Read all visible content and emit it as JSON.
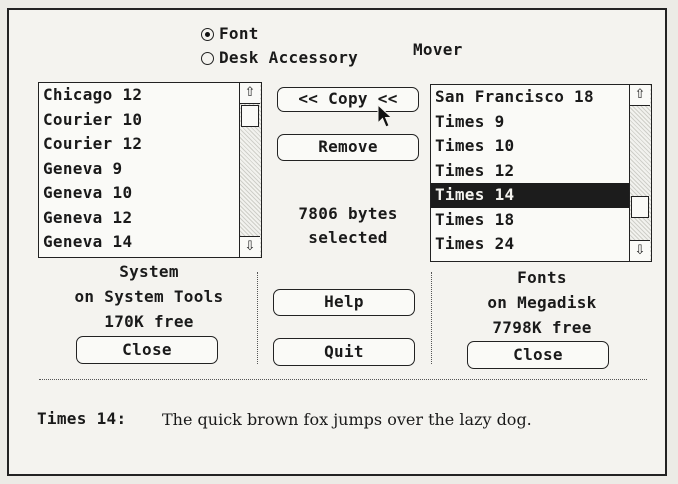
{
  "title": "Mover",
  "mode": {
    "options": [
      "Font",
      "Desk Accessory"
    ],
    "selected": "Font"
  },
  "left_list": {
    "items": [
      "Chicago 12",
      "Courier 10",
      "Courier 12",
      "Geneva 9",
      "Geneva 10",
      "Geneva 12",
      "Geneva 14"
    ]
  },
  "right_list": {
    "items": [
      "San Francisco 18",
      "Times 9",
      "Times 10",
      "Times 12",
      "Times 14",
      "Times 18",
      "Times 24"
    ],
    "selected_index": 4,
    "scroll_position": 0.8
  },
  "buttons": {
    "copy": "<< Copy <<",
    "remove": "Remove",
    "help": "Help",
    "quit": "Quit",
    "close_left": "Close",
    "close_right": "Close"
  },
  "selection_info": {
    "line1": "7806 bytes",
    "line2": "selected"
  },
  "left_info": {
    "file": "System",
    "disk": "on System Tools",
    "free": "170K free"
  },
  "right_info": {
    "file": "Fonts",
    "disk": "on Megadisk",
    "free": "7798K free"
  },
  "sample": {
    "label": "Times 14:",
    "text": "The quick brown fox jumps over the lazy dog."
  }
}
